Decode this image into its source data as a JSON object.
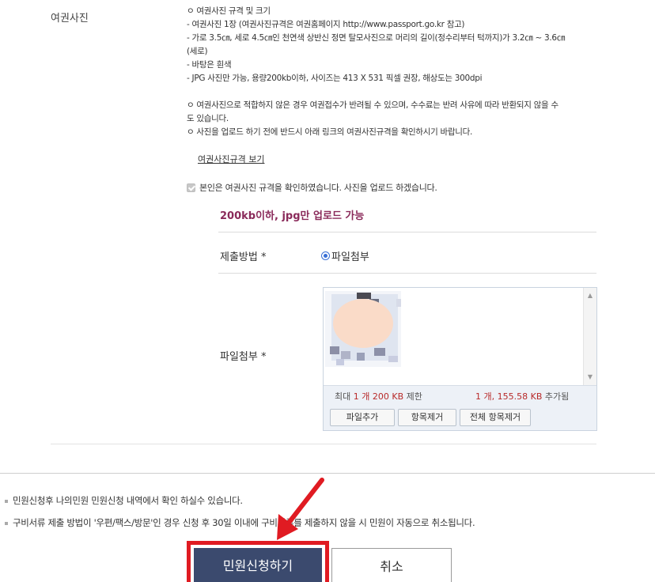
{
  "section": {
    "label": "여권사진"
  },
  "rules": {
    "lines": [
      "ㅇ 여권사진 규격 및 크기",
      "  - 여권사진 1장 (여권사진규격은 여권홈페이지 http://www.passport.go.kr 참고)",
      "  - 가로 3.5㎝, 세로 4.5㎝인 천연색 상반신 정면 탈모사진으로 머리의 길이(정수리부터 턱까지)가 3.2㎝ ~ 3.6㎝",
      "(세로)",
      "  - 바탕은 흰색",
      "  - JPG 사진만 가능, 용량200kb이하, 사이즈는 413 X 531 픽셀 권장, 해상도는 300dpi",
      "",
      "ㅇ 여권사진으로 적합하지 않은 경우 여권접수가 반려될 수 있으며, 수수료는 반려 사유에 따라 반환되지 않을 수",
      "도 있습니다.",
      "ㅇ 사진을 업로드 하기 전에 반드시 아래 링크의 여권사진규격을 확인하시기 바랍니다."
    ],
    "link_label": "여권사진규격 보기"
  },
  "agree": {
    "label": "본인은 여권사진 규격을 확인하였습니다. 사진을 업로드 하겠습니다.",
    "checked": true
  },
  "upload": {
    "note": "200kb이하, jpg만 업로드 가능",
    "submit_method_label": "제출방법 *",
    "submit_method_option": "파일첨부",
    "file_label": "파일첨부 *",
    "limit_prefix": "최대",
    "limit_count": "1 개",
    "limit_size": "200 KB",
    "limit_suffix": "제한",
    "added_count": "1 개,",
    "added_size": "155.58 KB",
    "added_suffix": "추가됨",
    "buttons": {
      "add": "파일추가",
      "remove": "항목제거",
      "remove_all": "전체 항목제거"
    }
  },
  "notices": [
    "민원신청후 나의민원 민원신청 내역에서 확인 하실수 있습니다.",
    "구비서류 제출 방법이 '우편/팩스/방문'인 경우 신청 후 30일 이내에 구비서류를 제출하지 않을 시 민원이 자동으로 취소됩니다."
  ],
  "actions": {
    "apply": "민원신청하기",
    "cancel": "취소"
  },
  "colors": {
    "apply_bg": "#3b4a6e",
    "highlight": "#e01b22",
    "note": "#8a2a5a"
  }
}
